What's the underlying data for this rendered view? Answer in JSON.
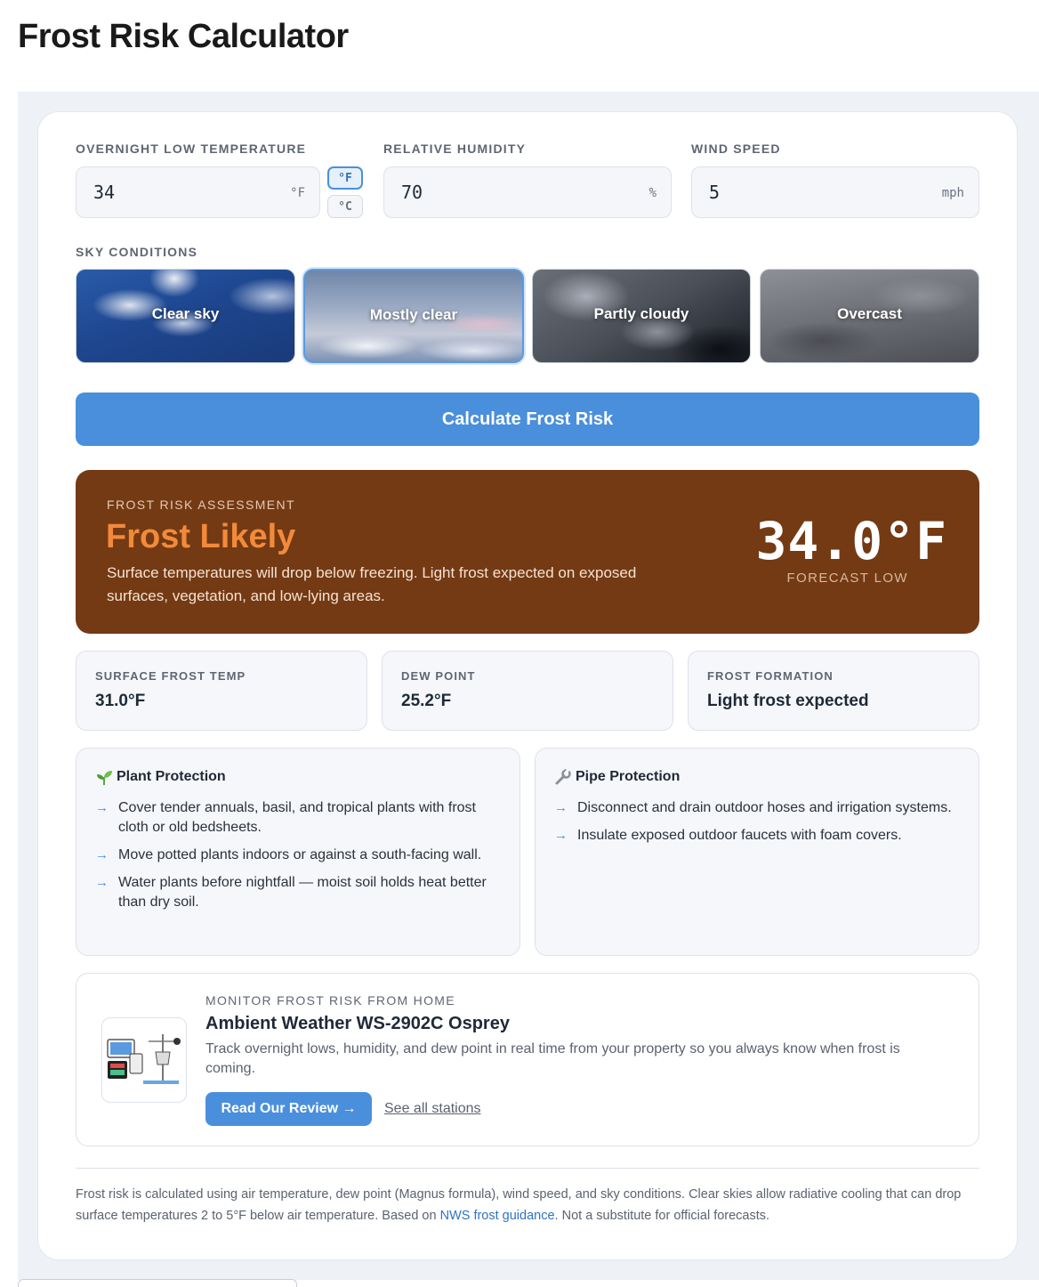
{
  "page": {
    "title": "Frost Risk Calculator"
  },
  "inputs": {
    "temperature": {
      "label": "OVERNIGHT LOW TEMPERATURE",
      "value": "34",
      "unit": "°F"
    },
    "humidity": {
      "label": "RELATIVE HUMIDITY",
      "value": "70",
      "unit": "%"
    },
    "wind": {
      "label": "WIND SPEED",
      "value": "5",
      "unit": "mph"
    },
    "unit_toggle": {
      "fahrenheit": "°F",
      "celsius": "°C",
      "selected": "°F"
    }
  },
  "sky": {
    "label": "SKY CONDITIONS",
    "options": [
      "Clear sky",
      "Mostly clear",
      "Partly cloudy",
      "Overcast"
    ],
    "selected": "Mostly clear"
  },
  "calculate_label": "Calculate Frost Risk",
  "result": {
    "eyebrow": "FROST RISK ASSESSMENT",
    "title": "Frost Likely",
    "description": "Surface temperatures will drop below freezing. Light frost expected on exposed surfaces, vegetation, and low-lying areas.",
    "temp": "34.0°F",
    "temp_label": "FORECAST LOW",
    "panel_color": "#733a14",
    "title_color": "#f28a3a"
  },
  "stats": [
    {
      "label": "SURFACE FROST TEMP",
      "value": "31.0°F"
    },
    {
      "label": "DEW POINT",
      "value": "25.2°F"
    },
    {
      "label": "FROST FORMATION",
      "value": "Light frost expected"
    }
  ],
  "plant_protection": {
    "title": "Plant Protection",
    "icon": "seedling-icon",
    "tips": [
      "Cover tender annuals, basil, and tropical plants with frost cloth or old bedsheets.",
      "Move potted plants indoors or against a south-facing wall.",
      "Water plants before nightfall — moist soil holds heat better than dry soil."
    ]
  },
  "pipe_protection": {
    "title": "Pipe Protection",
    "icon": "wrench-icon",
    "tips": [
      "Disconnect and drain outdoor hoses and irrigation systems.",
      "Insulate exposed outdoor faucets with foam covers."
    ]
  },
  "promo": {
    "eyebrow": "MONITOR FROST RISK FROM HOME",
    "title": "Ambient Weather WS-2902C Osprey",
    "description": "Track overnight lows, humidity, and dew point in real time from your property so you always know when frost is coming.",
    "button": "Read Our Review →",
    "link": "See all stations"
  },
  "footnote": {
    "before": "Frost risk is calculated using air temperature, dew point (Magnus formula), wind speed, and sky conditions. Clear skies allow radiative cooling that can drop surface temperatures 2 to 5°F below air temperature. Based on ",
    "link": "NWS frost guidance",
    "after": ". Not a substitute for official forecasts."
  },
  "colors": {
    "accent": "#4a8fdc",
    "arrow": "#4a8fdc"
  }
}
